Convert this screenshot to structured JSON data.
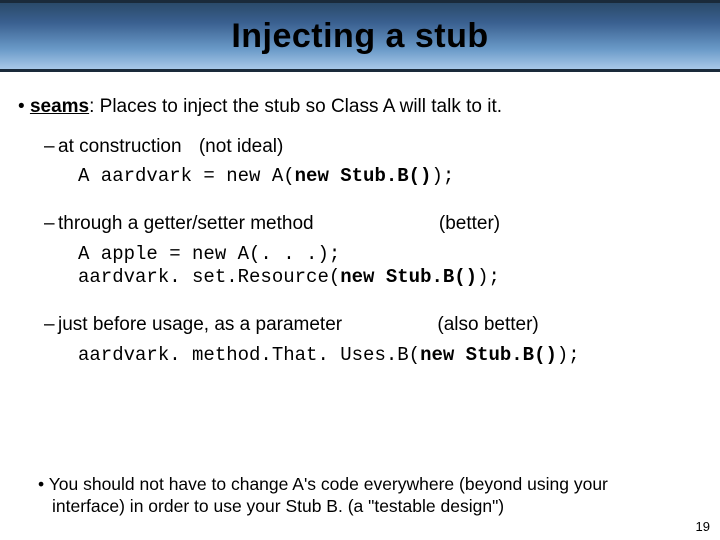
{
  "title": "Injecting a stub",
  "bullet": {
    "term": "seams",
    "rest": ": Places to inject the stub so Class A will talk to it."
  },
  "items": [
    {
      "label": "at construction",
      "note": "(not ideal)",
      "code": "A aardvark = new A(new Stub.B());"
    },
    {
      "label": "through a getter/setter method",
      "note": "(better)",
      "code": "A apple = new A(. . .);\naardvark. set.Resource(new Stub.B());"
    },
    {
      "label": "just before usage, as a parameter",
      "note": "(also better)",
      "code": "aardvark. method.That. Uses.B(new Stub.B());"
    }
  ],
  "footer": "You should not have to change A's code everywhere (beyond using your interface) in order to use your Stub B.   (a \"testable design\")",
  "page": "19"
}
